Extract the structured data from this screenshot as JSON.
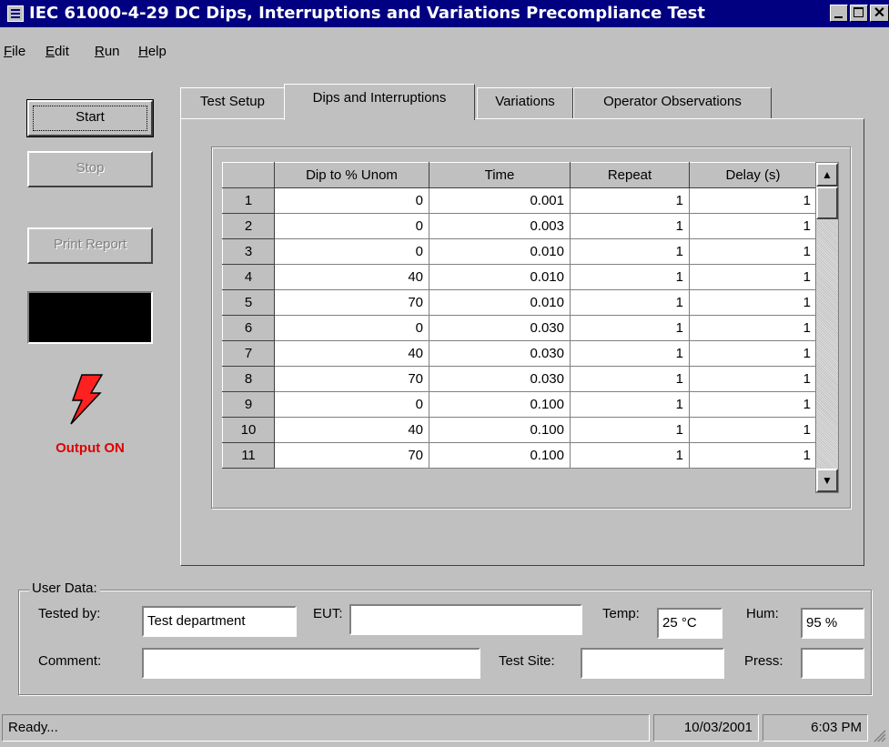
{
  "window": {
    "title": "IEC 61000-4-29 DC Dips, Interruptions and Variations Precompliance Test"
  },
  "menu": [
    {
      "label": "File",
      "mnemonic": "F",
      "rest": "ile"
    },
    {
      "label": "Edit",
      "mnemonic": "E",
      "rest": "dit"
    },
    {
      "label": "Run",
      "mnemonic": "R",
      "rest": "un"
    },
    {
      "label": "Help",
      "mnemonic": "H",
      "rest": "elp"
    }
  ],
  "buttons": {
    "start": "Start",
    "stop": "Stop",
    "print_report": "Print Report"
  },
  "output_status": "Output ON",
  "tabs": [
    "Test Setup",
    "Dips and Interruptions",
    "Variations",
    "Operator Observations"
  ],
  "active_tab": "Dips and Interruptions",
  "grid": {
    "columns": [
      "",
      "Dip to % Unom",
      "Time",
      "Repeat",
      "Delay (s)"
    ],
    "rows": [
      [
        "1",
        "0",
        "0.001",
        "1",
        "1"
      ],
      [
        "2",
        "0",
        "0.003",
        "1",
        "1"
      ],
      [
        "3",
        "0",
        "0.010",
        "1",
        "1"
      ],
      [
        "4",
        "40",
        "0.010",
        "1",
        "1"
      ],
      [
        "5",
        "70",
        "0.010",
        "1",
        "1"
      ],
      [
        "6",
        "0",
        "0.030",
        "1",
        "1"
      ],
      [
        "7",
        "40",
        "0.030",
        "1",
        "1"
      ],
      [
        "8",
        "70",
        "0.030",
        "1",
        "1"
      ],
      [
        "9",
        "0",
        "0.100",
        "1",
        "1"
      ],
      [
        "10",
        "40",
        "0.100",
        "1",
        "1"
      ],
      [
        "11",
        "70",
        "0.100",
        "1",
        "1"
      ]
    ]
  },
  "user_data": {
    "legend": "User Data:",
    "tested_by_label": "Tested by:",
    "tested_by_value": "Test department",
    "eut_label": "EUT:",
    "eut_value": "",
    "temp_label": "Temp:",
    "temp_value": "25 °C",
    "hum_label": "Hum:",
    "hum_value": "95 %",
    "comment_label": "Comment:",
    "comment_value": "",
    "test_site_label": "Test Site:",
    "test_site_value": "",
    "press_label": "Press:",
    "press_value": ""
  },
  "statusbar": {
    "message": "Ready...",
    "date": "10/03/2001",
    "time": "6:03 PM"
  },
  "colors": {
    "titlebar": "#000080",
    "face": "#c0c0c0",
    "output_on": "#e00000"
  }
}
